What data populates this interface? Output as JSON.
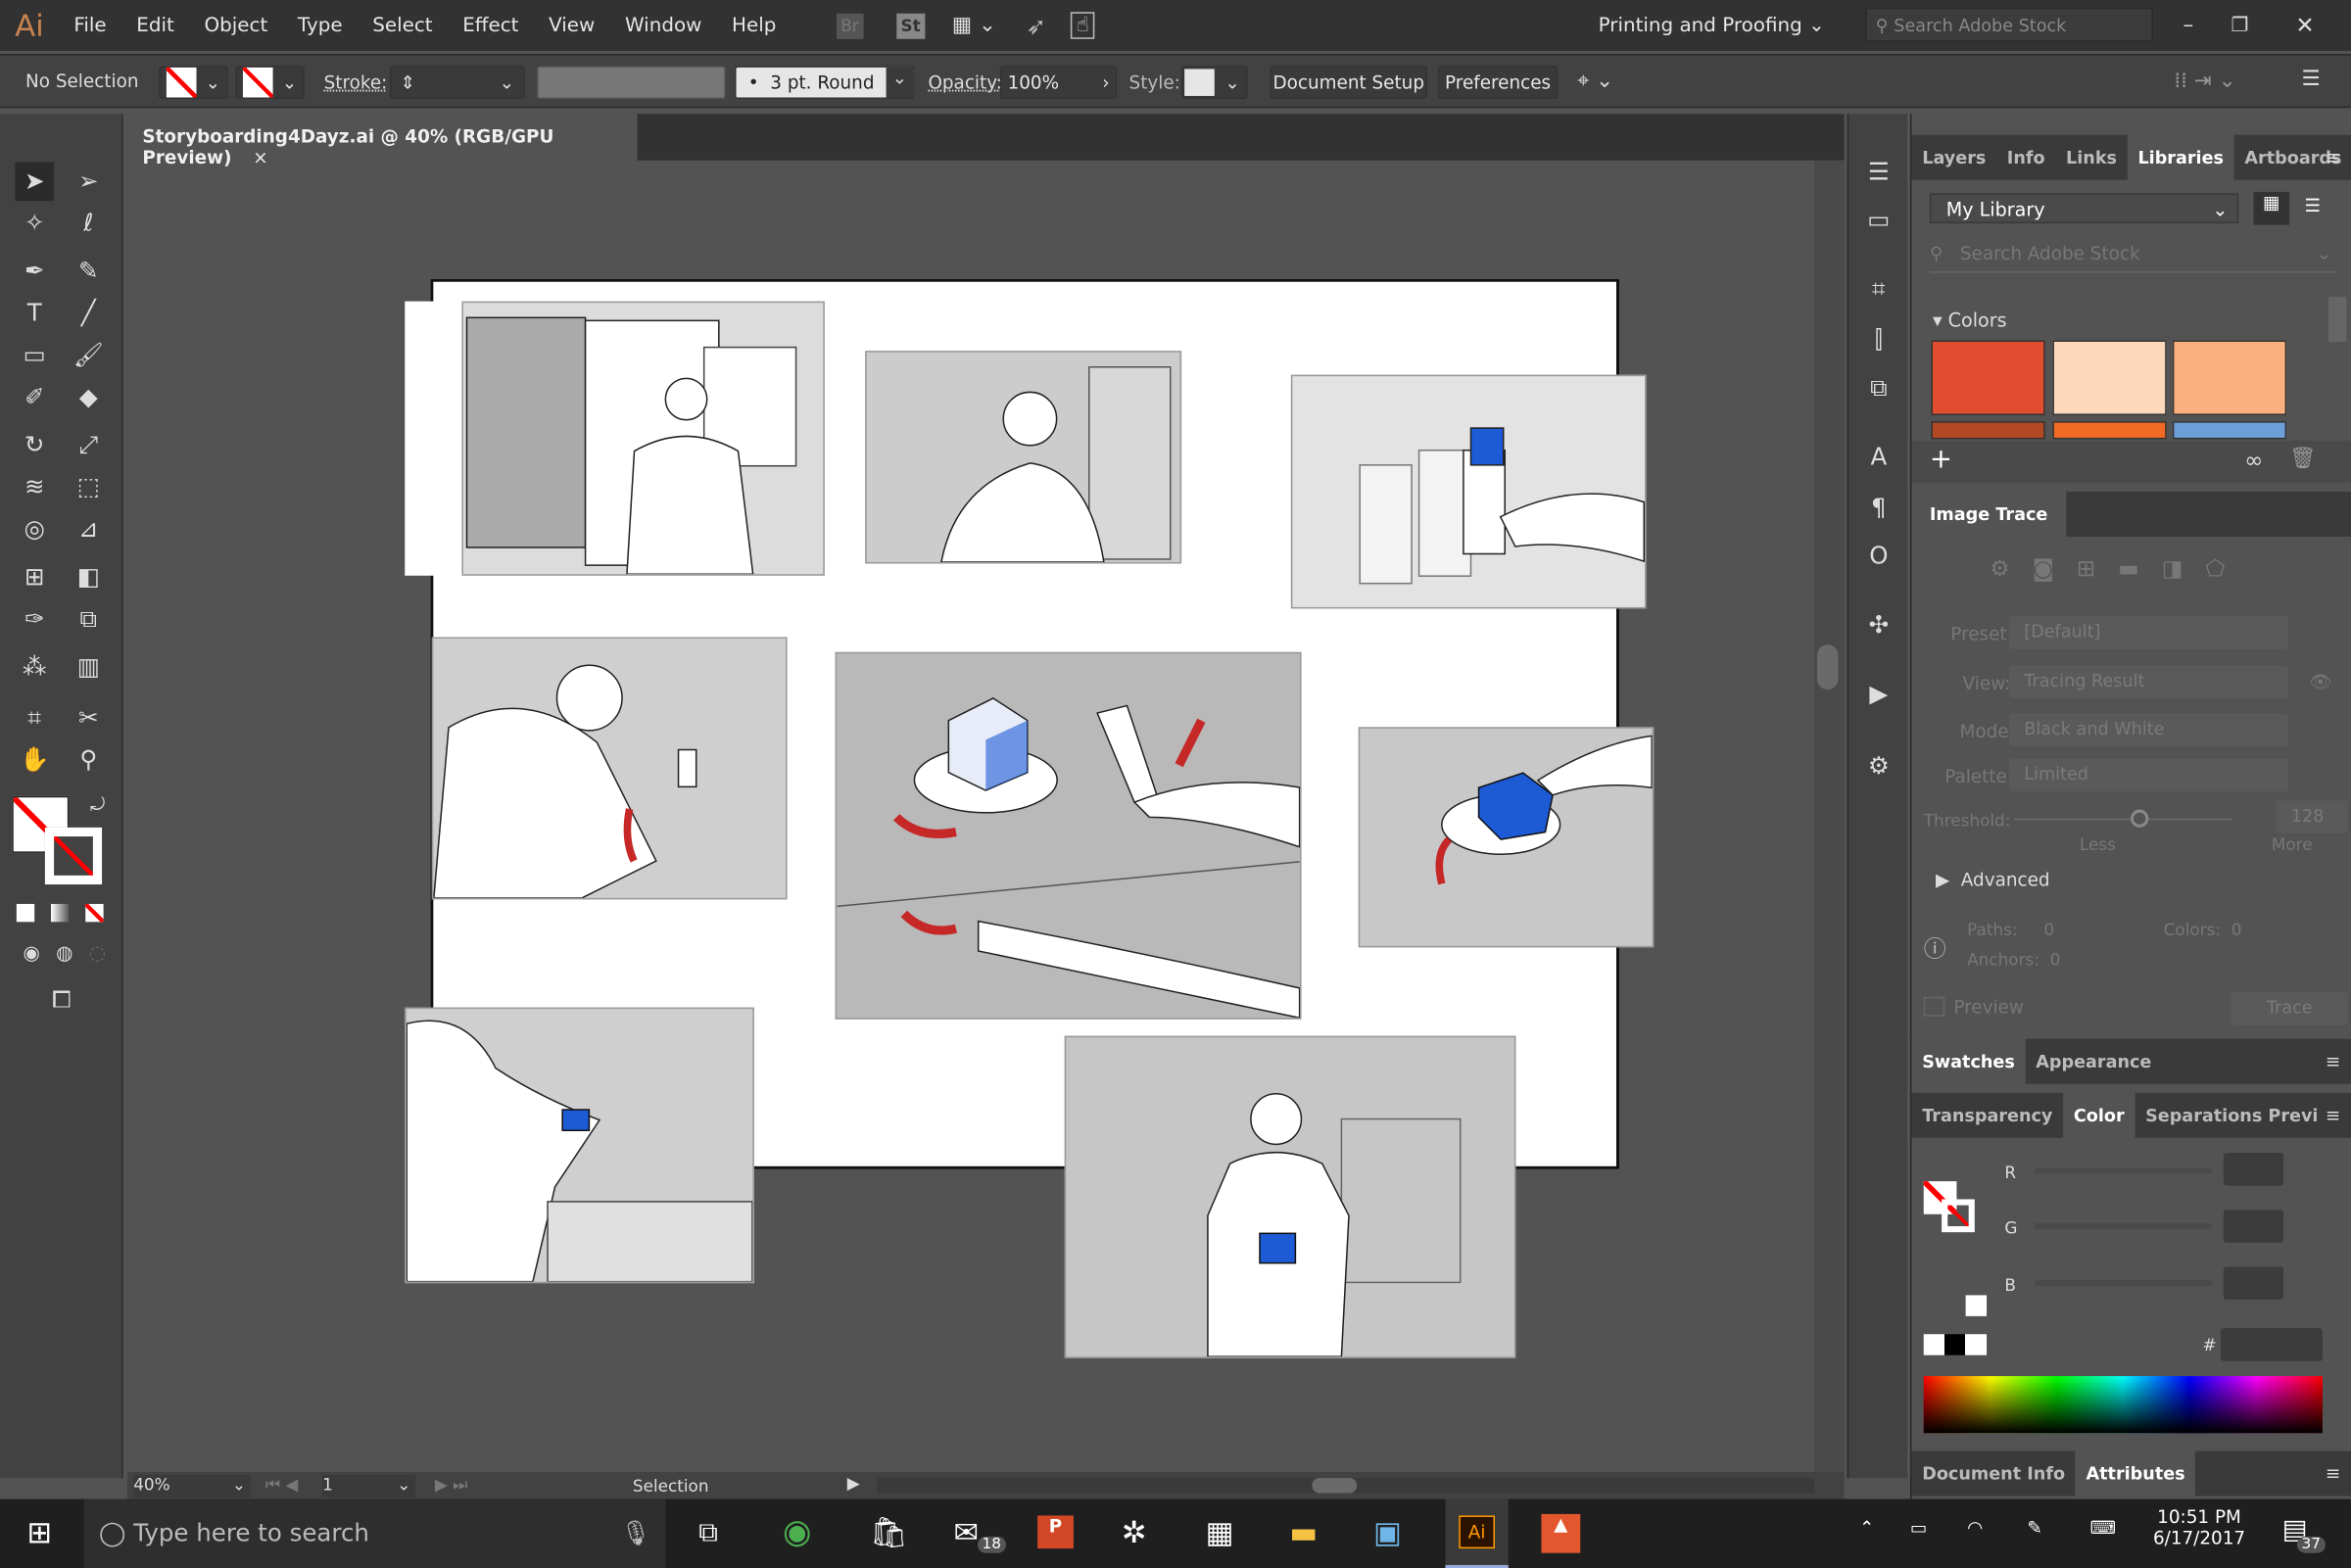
{
  "menubar": {
    "app": "Ai",
    "items": [
      "File",
      "Edit",
      "Object",
      "Type",
      "Select",
      "Effect",
      "View",
      "Window",
      "Help"
    ],
    "bridge": "Br",
    "stock": "St",
    "workspace": "Printing and Proofing",
    "search_placeholder": "Search Adobe Stock"
  },
  "control": {
    "selection": "No Selection",
    "stroke_label": "Stroke:",
    "brush": "3 pt. Round",
    "opacity_label": "Opacity:",
    "opacity": "100%",
    "style_label": "Style:",
    "document_setup": "Document Setup",
    "preferences": "Preferences"
  },
  "document": {
    "tab": "Storyboarding4Dayz.ai @ 40% (RGB/GPU Preview)",
    "close": "×"
  },
  "status": {
    "zoom": "40%",
    "artboard": "1",
    "tool": "Selection"
  },
  "libraries": {
    "tabs": [
      "Layers",
      "Info",
      "Links",
      "Libraries",
      "Artboards"
    ],
    "active": "Libraries",
    "library": "My Library",
    "search_placeholder": "Search Adobe Stock",
    "colors_label": "Colors",
    "colors": [
      "#e14e2f",
      "#fdd8bb",
      "#fab07e",
      "#b24924",
      "#f26a23",
      "#6c9fd8"
    ]
  },
  "image_trace": {
    "title": "Image Trace",
    "preset_label": "Preset:",
    "preset": "[Default]",
    "view_label": "View:",
    "view": "Tracing Result",
    "mode_label": "Mode:",
    "mode": "Black and White",
    "palette_label": "Palette:",
    "palette": "Limited",
    "threshold_label": "Threshold:",
    "threshold": "128",
    "less": "Less",
    "more": "More",
    "advanced": "Advanced",
    "paths_label": "Paths:",
    "paths": "0",
    "colors_label": "Colors:",
    "colors": "0",
    "anchors_label": "Anchors:",
    "anchors": "0",
    "preview": "Preview",
    "trace": "Trace"
  },
  "swatches_tabs": [
    "Swatches",
    "Appearance"
  ],
  "color_tabs": [
    "Transparency",
    "Color",
    "Separations Previ"
  ],
  "color": {
    "r": "R",
    "g": "G",
    "b": "B",
    "hash": "#"
  },
  "bottom_tabs": [
    "Document Info",
    "Attributes"
  ],
  "taskbar": {
    "search": "Type here to search",
    "time": "10:51 PM",
    "date": "6/17/2017",
    "mail_badge": "18",
    "notif_badge": "37"
  }
}
